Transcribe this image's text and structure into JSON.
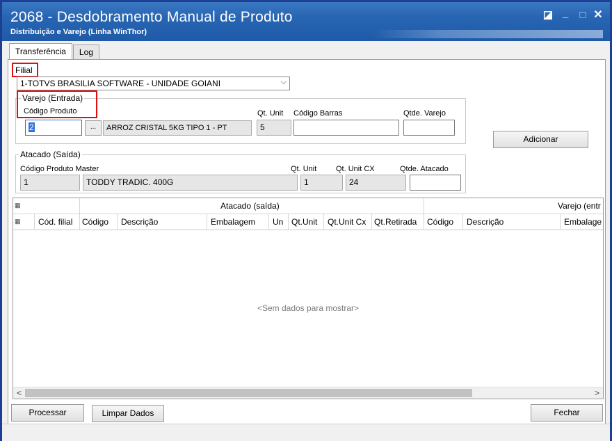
{
  "window": {
    "title": "2068 - Desdobramento Manual de Produto",
    "subtitle": "Distribuição e Varejo (Linha WinThor)",
    "controls": {
      "restore": "◪",
      "minimize": "_",
      "maximize": "□",
      "close": "✕"
    }
  },
  "tabs": [
    {
      "label": "Transferência",
      "active": true
    },
    {
      "label": "Log",
      "active": false
    }
  ],
  "filial": {
    "label": "Filial",
    "value": "1-TOTVS BRASILIA SOFTWARE - UNIDADE GOIANI",
    "arrow": "⌵"
  },
  "varejo": {
    "title": "Varejo (Entrada)",
    "codigo_label": "Código Produto",
    "codigo_value": "2",
    "lookup_label": "...",
    "descricao": "ARROZ CRISTAL 5KG TIPO 1 - PT",
    "qt_unit_label": "Qt. Unit",
    "qt_unit_value": "5",
    "codigo_barras_label": "Código Barras",
    "codigo_barras_value": "",
    "qtde_varejo_label": "Qtde. Varejo",
    "qtde_varejo_value": ""
  },
  "adicionar_label": "Adicionar",
  "atacado": {
    "title": "Atacado (Saída)",
    "codigo_master_label": "Código Produto Master",
    "codigo_master_value": "1",
    "descricao": "TODDY TRADIC. 400G",
    "qt_unit_label": "Qt. Unit",
    "qt_unit_value": "1",
    "qt_unit_cx_label": "Qt. Unit CX",
    "qt_unit_cx_value": "24",
    "qtde_atacado_label": "Qtde. Atacado",
    "qtde_atacado_value": ""
  },
  "grid": {
    "group_atacado": "Atacado (saída)",
    "group_varejo": "Varejo (entr",
    "columns": [
      "Cód. filial",
      "Código",
      "Descrição",
      "Embalagem",
      "Un",
      "Qt.Unit",
      "Qt.Unit Cx",
      "Qt.Retirada",
      "Código",
      "Descrição",
      "Embalage"
    ],
    "empty_text": "<Sem dados para mostrar>",
    "scroll_left": "<",
    "scroll_right": ">",
    "row_icon": "▦"
  },
  "buttons": {
    "processar": "Processar",
    "limpar": "Limpar Dados",
    "fechar": "Fechar"
  }
}
